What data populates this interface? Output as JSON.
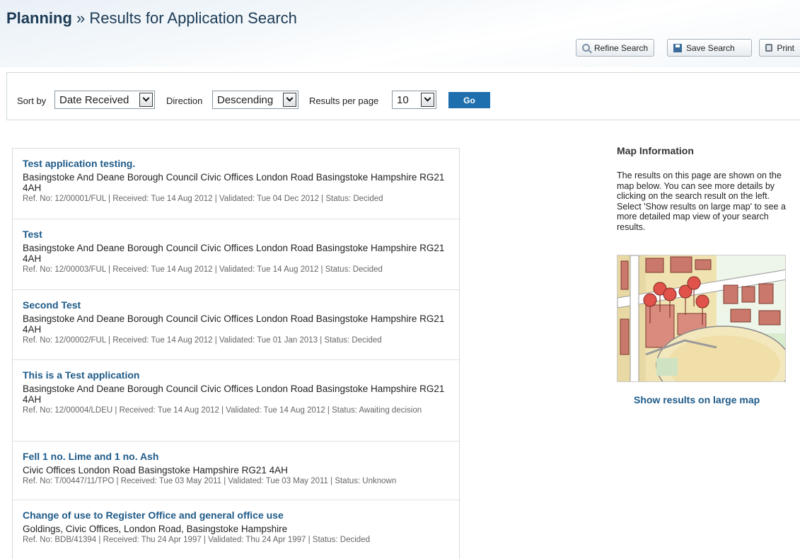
{
  "header": {
    "section": "Planning",
    "separator": "»",
    "title": "Results for Application Search"
  },
  "toolbar": {
    "refine_label": "Refine Search",
    "save_label": "Save Search",
    "print_label": "Print"
  },
  "sort_bar": {
    "sort_by_label": "Sort by",
    "sort_by_value": "Date Received",
    "direction_label": "Direction",
    "direction_value": "Descending",
    "per_page_label": "Results per page",
    "per_page_value": "10",
    "go_label": "Go"
  },
  "results": [
    {
      "title": "Test application testing.",
      "address": "Basingstoke And Deane Borough Council Civic Offices London Road Basingstoke Hampshire RG21 4AH",
      "meta": "Ref. No: 12/00001/FUL | Received: Tue 14 Aug 2012 | Validated: Tue 04 Dec 2012 | Status: Decided"
    },
    {
      "title": "Test",
      "address": "Basingstoke And Deane Borough Council Civic Offices London Road Basingstoke Hampshire RG21 4AH",
      "meta": "Ref. No: 12/00003/FUL | Received: Tue 14 Aug 2012 | Validated: Tue 14 Aug 2012 | Status: Decided"
    },
    {
      "title": "Second Test",
      "address": "Basingstoke And Deane Borough Council Civic Offices London Road Basingstoke Hampshire RG21 4AH",
      "meta": "Ref. No: 12/00002/FUL | Received: Tue 14 Aug 2012 | Validated: Tue 01 Jan 2013 | Status: Decided"
    },
    {
      "title": "This is a Test application",
      "address": "Basingstoke And Deane Borough Council Civic Offices London Road Basingstoke Hampshire RG21 4AH",
      "meta": "Ref. No: 12/00004/LDEU | Received: Tue 14 Aug 2012 | Validated: Tue 14 Aug 2012 | Status: Awaiting decision"
    },
    {
      "title": "Fell 1 no. Lime and 1 no. Ash",
      "address": "Civic Offices London Road Basingstoke Hampshire RG21 4AH",
      "meta": "Ref. No: T/00447/11/TPO | Received: Tue 03 May 2011 | Validated: Tue 03 May 2011 | Status: Unknown"
    },
    {
      "title": "Change of use to Register Office and general office use",
      "address": "Goldings, Civic Offices, London Road, Basingstoke Hampshire",
      "meta": "Ref. No: BDB/41394 | Received: Thu 24 Apr 1997 | Validated: Thu 24 Apr 1997 | Status: Decided"
    }
  ],
  "map": {
    "heading": "Map Information",
    "description": "The results on this page are shown on the map below. You can see more details by clicking on the search result on the left. Select 'Show results on large map' to see a more detailed map view of your search results.",
    "link_label": "Show results on large map",
    "marker_color": "#e0524a"
  }
}
